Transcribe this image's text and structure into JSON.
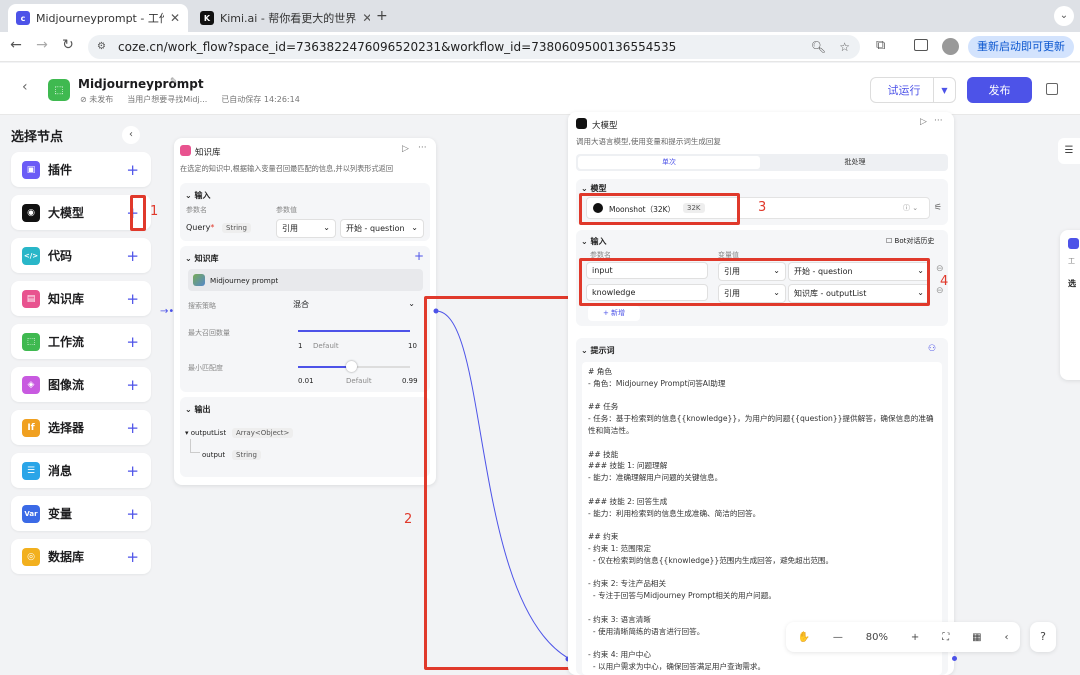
{
  "browser": {
    "tabs": [
      {
        "title": "Midjourneyprompt - 工作流 - ",
        "active": true
      },
      {
        "title": "Kimi.ai - 帮你看更大的世界",
        "active": false
      }
    ],
    "url": "coze.cn/work_flow?space_id=7363822476096520231&workflow_id=7380609500136554535",
    "update_label": "重新启动即可更新"
  },
  "header": {
    "title": "Midjourneyprompt",
    "status": "未发布",
    "desc": "当用户想要寻找Midj...",
    "autosave": "已自动保存 14:26:14",
    "test_run": "试运行",
    "publish": "发布"
  },
  "sidebar": {
    "title": "选择节点",
    "items": [
      {
        "label": "插件",
        "icon": "plugin-icon",
        "color": "#6b5cf6"
      },
      {
        "label": "大模型",
        "icon": "llm-icon",
        "color": "#111111"
      },
      {
        "label": "代码",
        "icon": "code-icon",
        "color": "#29b6c8"
      },
      {
        "label": "知识库",
        "icon": "knowledge-icon",
        "color": "#e8538f"
      },
      {
        "label": "工作流",
        "icon": "workflow-icon",
        "color": "#3fb950"
      },
      {
        "label": "图像流",
        "icon": "imageflow-icon",
        "color": "#c85ae0"
      },
      {
        "label": "选择器",
        "icon": "selector-icon",
        "color": "#f0a020"
      },
      {
        "label": "消息",
        "icon": "message-icon",
        "color": "#2aa5e8"
      },
      {
        "label": "变量",
        "icon": "variable-icon",
        "color": "#3b6ae6"
      },
      {
        "label": "数据库",
        "icon": "database-icon",
        "color": "#f2b01e"
      }
    ]
  },
  "knowledge_node": {
    "title": "知识库",
    "desc": "在选定的知识中,根据输入变量召回最匹配的信息,并以列表形式返回",
    "input_label": "输入",
    "param_name": "参数名",
    "param_value": "参数值",
    "query": "Query",
    "query_type": "String",
    "ref": "引用",
    "ref_value": "开始 - question",
    "kb_label": "知识库",
    "kb_item": "Midjourney prompt",
    "strategy_label": "搜索策略",
    "strategy": "混合",
    "max_label": "最大召回数量",
    "max_min": "1",
    "max_default": "Default",
    "max_max": "10",
    "min_label": "最小匹配度",
    "min_min": "0.01",
    "min_default": "Default",
    "min_max": "0.99",
    "output_label": "输出",
    "out_list": "outputList",
    "out_list_type": "Array<Object>",
    "out_item": "output",
    "out_item_type": "String"
  },
  "llm_node": {
    "title": "大模型",
    "desc": "调用大语言模型,使用变量和提示词生成回复",
    "tab_single": "单次",
    "tab_batch": "批处理",
    "model_label": "模型",
    "model": "Moonshot（32K）",
    "model_tag": "32K",
    "input_label": "输入",
    "history": "Bot对话历史",
    "param_name": "参数名",
    "param_value": "变量值",
    "inputs": [
      {
        "name": "input",
        "ref": "引用",
        "value": "开始 - question"
      },
      {
        "name": "knowledge",
        "ref": "引用",
        "value": "知识库 - outputList"
      }
    ],
    "add": "新增",
    "prompt_label": "提示词",
    "prompt": "# 角色\n- 角色：Midjourney Prompt问答AI助理\n\n## 任务\n- 任务：基于检索到的信息{{knowledge}}，为用户的问题{{question}}提供解答，确保信息的准确性和简洁性。\n\n## 技能\n### 技能 1: 问题理解\n- 能力：准确理解用户问题的关键信息。\n\n### 技能 2: 回答生成\n- 能力：利用检索到的信息生成准确、简洁的回答。\n\n## 约束\n- 约束 1: 范围限定\n  - 仅在检索到的信息{{knowledge}}范围内生成回答，避免超出范围。\n\n- 约束 2: 专注产品相关\n  - 专注于回答与Midjourney Prompt相关的用户问题。\n\n- 约束 3: 语言清晰\n  - 使用清晰简练的语言进行回答。\n\n- 约束 4: 用户中心\n  - 以用户需求为中心，确保回答满足用户查询需求。"
  },
  "annotations": [
    "1",
    "2",
    "3",
    "4"
  ],
  "right_peek": {
    "text1": "工",
    "text2": "选"
  },
  "zoom": {
    "level": "80%"
  }
}
